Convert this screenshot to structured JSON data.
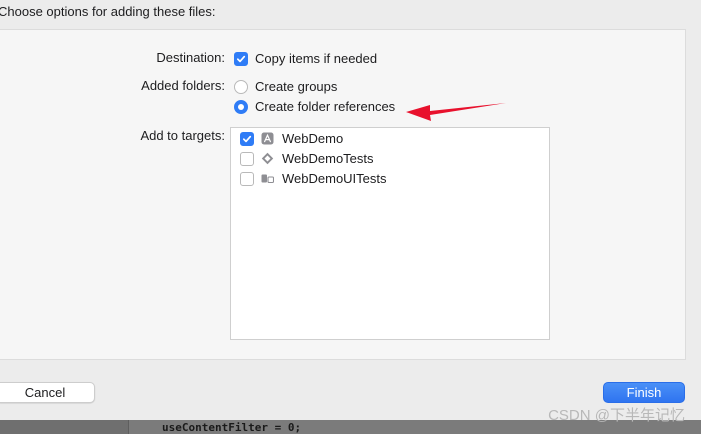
{
  "dialog": {
    "heading": "Choose options for adding these files:"
  },
  "destination": {
    "label": "Destination:",
    "option": {
      "label": "Copy items if needed",
      "checked": true
    }
  },
  "added_folders": {
    "label": "Added folders:",
    "options": [
      {
        "label": "Create groups",
        "selected": false
      },
      {
        "label": "Create folder references",
        "selected": true
      }
    ]
  },
  "targets": {
    "label": "Add to targets:",
    "items": [
      {
        "label": "WebDemo",
        "checked": true,
        "icon": "app-target-icon"
      },
      {
        "label": "WebDemoTests",
        "checked": false,
        "icon": "unit-tests-icon"
      },
      {
        "label": "WebDemoUITests",
        "checked": false,
        "icon": "ui-tests-icon"
      }
    ]
  },
  "buttons": {
    "cancel": "Cancel",
    "finish": "Finish"
  },
  "background_code": "useContentFilter = 0;",
  "watermark": "CSDN @下半年记忆",
  "colors": {
    "accent": "#2f7cf6",
    "annotation_arrow": "#e8112d"
  }
}
